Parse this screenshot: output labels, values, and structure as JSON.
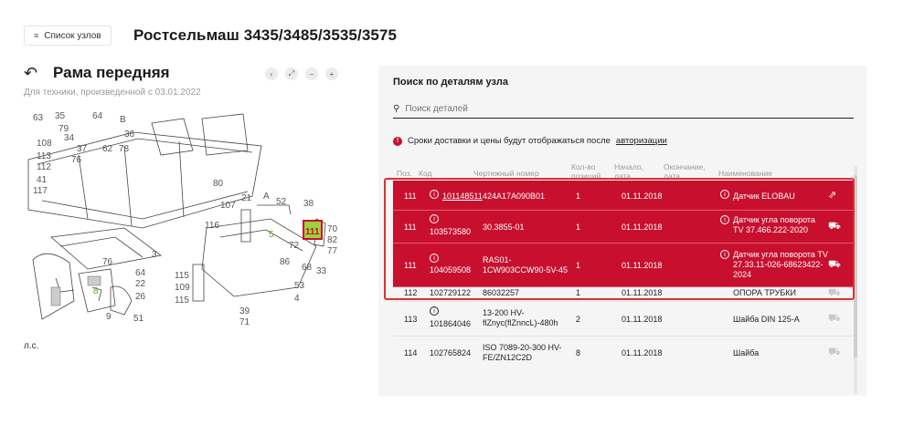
{
  "topbar": {
    "list_button": "Список узлов",
    "title": "Ростсельмаш 3435/3485/3535/3575"
  },
  "assembly": {
    "title": "Рама передняя",
    "subtitle": "Для техники, произведенной с 03.01.2022",
    "footnote": "л.с."
  },
  "diagram": {
    "labels": [
      "63",
      "35",
      "79",
      "64",
      "B",
      "36",
      "108",
      "34",
      "37",
      "62",
      "78",
      "113",
      "76",
      "112",
      "41",
      "80",
      "117",
      "3",
      "107",
      "21",
      "A",
      "52",
      "38",
      "116",
      "5",
      "111",
      "70",
      "82",
      "77",
      "72",
      "86",
      "68",
      "33",
      "76",
      "64",
      "22",
      "8",
      "26",
      "9",
      "51",
      "115",
      "109",
      "115",
      "53",
      "4",
      "39",
      "71"
    ],
    "highlight_label": "111"
  },
  "panel": {
    "title": "Поиск по деталям узла",
    "search_placeholder": "Поиск деталей",
    "notice_text": "Сроки доставки и цены будут отображаться после ",
    "notice_link": "авторизации",
    "columns": {
      "pos": "Поз.",
      "code": "Код",
      "drawing": "Чертежный номер",
      "qty_line1": "Кол-во",
      "qty_line2": "позиций",
      "start_line1": "Начало,",
      "start_line2": "дата",
      "end_line1": "Окончание,",
      "end_line2": "дата",
      "name": "Наименование"
    },
    "rows": [
      {
        "pos": "111",
        "code": "101148511",
        "drawing": "424A17A090B01",
        "qty": "1",
        "start": "01.11.2018",
        "name": "Датчик ELOBAU",
        "action": "external-link-icon"
      },
      {
        "pos": "111",
        "code": "103573580",
        "drawing": "30.3855-01",
        "qty": "1",
        "start": "01.11.2018",
        "name": "Датчик угла поворота TV 37.466.222-2020",
        "action": "cart-icon"
      },
      {
        "pos": "111",
        "code": "104059508",
        "drawing": "RAS01-1CW903CCW90-5V-45",
        "qty": "1",
        "start": "01.11.2018",
        "name": "Датчик угла поворота TV 27.33.11-026-68623422-2024",
        "action": "cart-icon"
      },
      {
        "pos": "112",
        "code": "102729122",
        "drawing": "86032257",
        "qty": "1",
        "start": "01.11.2018",
        "name": "ОПОРА ТРУБКИ",
        "action": "cart-icon"
      },
      {
        "pos": "113",
        "code": "101864046",
        "drawing": "13-200 HV-flZnyc(flZnncL)-480h",
        "qty": "2",
        "start": "01.11.2018",
        "name": "Шайба DIN 125-A",
        "action": "cart-icon"
      },
      {
        "pos": "114",
        "code": "102765824",
        "drawing": "ISO 7089-20-300 HV-FE/ZN12C2D",
        "qty": "8",
        "start": "01.11.2018",
        "name": "Шайба",
        "action": "cart-icon"
      }
    ]
  },
  "colors": {
    "accent": "#c8102e",
    "frame": "#e0302f",
    "panel_bg": "#f5f5f5"
  }
}
